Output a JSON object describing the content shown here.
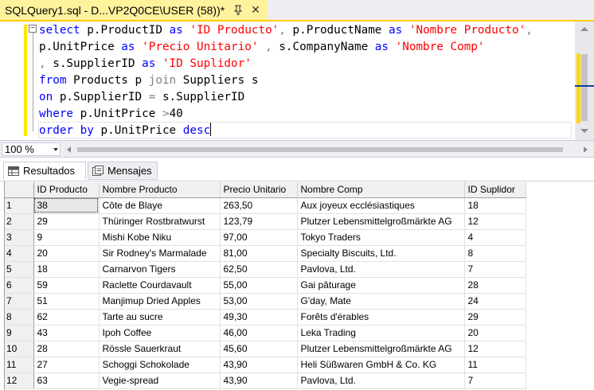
{
  "document_tab": {
    "title": "SQLQuery1.sql - D...VP2Q0CE\\USER (58))*",
    "close_glyph": "✕",
    "pin_icon": "pin-icon"
  },
  "editor": {
    "collapse_glyph": "−",
    "lines": [
      [
        {
          "t": "select",
          "c": "kw"
        },
        {
          "t": " p.ProductID ",
          "c": ""
        },
        {
          "t": "as",
          "c": "kw"
        },
        {
          "t": " ",
          "c": ""
        },
        {
          "t": "'ID Producto'",
          "c": "str"
        },
        {
          "t": ",",
          "c": "op"
        },
        {
          "t": " p.ProductName ",
          "c": ""
        },
        {
          "t": "as",
          "c": "kw"
        },
        {
          "t": " ",
          "c": ""
        },
        {
          "t": "'Nombre Producto'",
          "c": "str"
        },
        {
          "t": ",",
          "c": "op"
        }
      ],
      [
        {
          "t": "p.UnitPrice ",
          "c": ""
        },
        {
          "t": "as",
          "c": "kw"
        },
        {
          "t": " ",
          "c": ""
        },
        {
          "t": "'Precio Unitario'",
          "c": "str"
        },
        {
          "t": " ",
          "c": ""
        },
        {
          "t": ",",
          "c": "op"
        },
        {
          "t": " s.CompanyName ",
          "c": ""
        },
        {
          "t": "as",
          "c": "kw"
        },
        {
          "t": " ",
          "c": ""
        },
        {
          "t": "'Nombre Comp'",
          "c": "str"
        }
      ],
      [
        {
          "t": ",",
          "c": "op"
        },
        {
          "t": " s.SupplierID ",
          "c": ""
        },
        {
          "t": "as",
          "c": "kw"
        },
        {
          "t": " ",
          "c": ""
        },
        {
          "t": "'ID Suplidor'",
          "c": "str"
        }
      ],
      [
        {
          "t": "from",
          "c": "kw"
        },
        {
          "t": " Products p ",
          "c": ""
        },
        {
          "t": "join",
          "c": "op"
        },
        {
          "t": " Suppliers s",
          "c": ""
        }
      ],
      [
        {
          "t": "on",
          "c": "kw"
        },
        {
          "t": " p.SupplierID ",
          "c": ""
        },
        {
          "t": "=",
          "c": "op"
        },
        {
          "t": " s.SupplierID",
          "c": ""
        }
      ],
      [
        {
          "t": "where",
          "c": "kw"
        },
        {
          "t": " p.UnitPrice ",
          "c": ""
        },
        {
          "t": ">",
          "c": "op"
        },
        {
          "t": "40",
          "c": ""
        }
      ],
      [
        {
          "t": "order by",
          "c": "kw"
        },
        {
          "t": " p.UnitPrice ",
          "c": ""
        },
        {
          "t": "desc",
          "c": "kw"
        }
      ]
    ]
  },
  "toolbar": {
    "zoom": "100 %"
  },
  "results_tabs": {
    "results_label": "Resultados",
    "messages_label": "Mensajes"
  },
  "grid": {
    "columns": [
      "ID Producto",
      "Nombre Producto",
      "Precio Unitario",
      "Nombre Comp",
      "ID Suplidor"
    ],
    "rows": [
      [
        "1",
        "38",
        "Côte de Blaye",
        "263,50",
        "Aux joyeux ecclésiastiques",
        "18"
      ],
      [
        "2",
        "29",
        "Thüringer Rostbratwurst",
        "123,79",
        "Plutzer Lebensmittelgroßmärkte AG",
        "12"
      ],
      [
        "3",
        "9",
        "Mishi Kobe Niku",
        "97,00",
        "Tokyo Traders",
        "4"
      ],
      [
        "4",
        "20",
        "Sir Rodney's Marmalade",
        "81,00",
        "Specialty Biscuits, Ltd.",
        "8"
      ],
      [
        "5",
        "18",
        "Carnarvon Tigers",
        "62,50",
        "Pavlova, Ltd.",
        "7"
      ],
      [
        "6",
        "59",
        "Raclette Courdavault",
        "55,00",
        "Gai pâturage",
        "28"
      ],
      [
        "7",
        "51",
        "Manjimup Dried Apples",
        "53,00",
        "G'day, Mate",
        "24"
      ],
      [
        "8",
        "62",
        "Tarte au sucre",
        "49,30",
        "Forêts d'érables",
        "29"
      ],
      [
        "9",
        "43",
        "Ipoh Coffee",
        "46,00",
        "Leka Trading",
        "20"
      ],
      [
        "10",
        "28",
        "Rössle Sauerkraut",
        "45,60",
        "Plutzer Lebensmittelgroßmärkte AG",
        "12"
      ],
      [
        "11",
        "27",
        "Schoggi Schokolade",
        "43,90",
        "Heli Süßwaren GmbH & Co. KG",
        "11"
      ],
      [
        "12",
        "63",
        "Vegie-spread",
        "43,90",
        "Pavlova, Ltd.",
        "7"
      ]
    ]
  },
  "colors": {
    "keyword": "#0000ff",
    "string": "#ff0000",
    "operator": "#808080",
    "tab_active": "#fff29d",
    "tab_accent": "#ffcc00"
  }
}
